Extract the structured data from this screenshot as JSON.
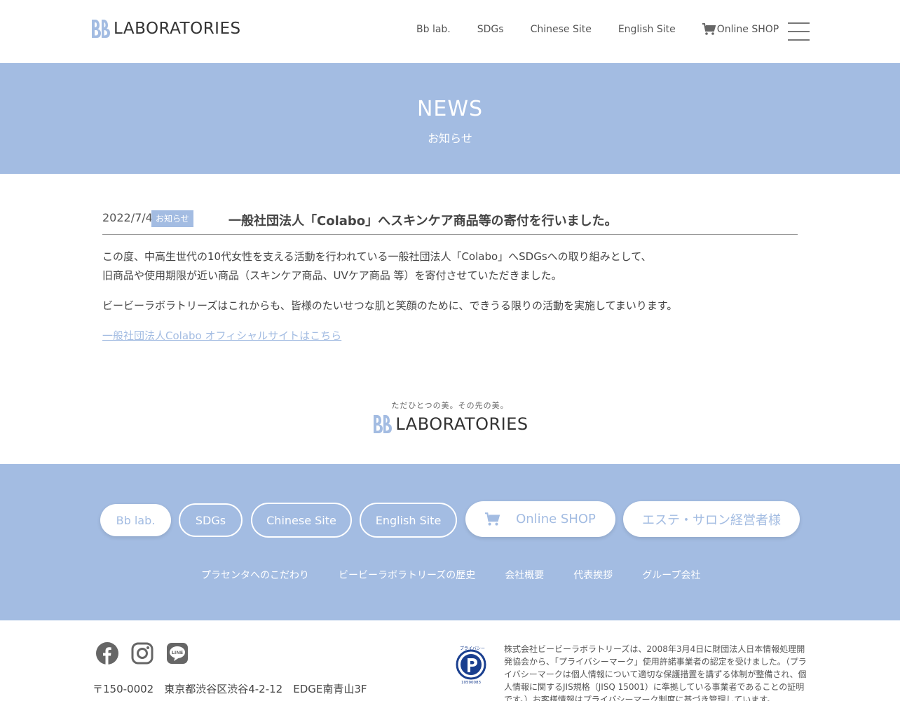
{
  "header": {
    "logo_mark": "Bb",
    "logo_text": "LABORATORIES",
    "nav": [
      "Bb lab.",
      "SDGs",
      "Chinese Site",
      "English Site"
    ],
    "shop_label": "Online SHOP"
  },
  "banner": {
    "title": "NEWS",
    "subtitle": "お知らせ"
  },
  "article": {
    "date": "2022/7/4",
    "badge": "お知らせ",
    "title": "一般社団法人「Colabo」へスキンケア商品等の寄付を行いました。",
    "para1_line1": "この度、中高生世代の10代女性を支える活動を行われている一般社団法人「Colabo」へSDGsへの取り組みとして、",
    "para1_line2": "旧商品や使用期限が近い商品（スキンケア商品、UVケア商品 等）を寄付させていただきました。",
    "para2": "ビービーラボラトリーズはこれからも、皆様のたいせつな肌と笑顔のために、できうる限りの活動を実施してまいります。",
    "link": "一般社団法人Colabo オフィシャルサイトはこちら"
  },
  "footer_logo": {
    "tagline": "ただひとつの美。その先の美。",
    "logo_mark": "Bb",
    "logo_text": "LABORATORIES"
  },
  "footer_nav": {
    "pills": [
      "Bb lab.",
      "SDGs",
      "Chinese Site",
      "English Site"
    ],
    "shop": "Online SHOP",
    "salon": "エステ・サロン経営者様",
    "links": [
      "プラセンタへのこだわり",
      "ビービーラボラトリーズの歴史",
      "会社概要",
      "代表挨拶",
      "グループ会社"
    ]
  },
  "bottom": {
    "address": "〒150-0002　東京都渋谷区渋谷4-2-12　EDGE南青山3F",
    "privacy_text": "株式会社ビービーラボラトリーズは、2008年3月4日に財団法人日本情報処理開発協会から、「プライバシーマーク」使用許諾事業者の認定を受けました。（プライバシーマークは個人情報について適切な保護措置を講ずる体制が整備され、個人情報に関するJIS規格（JISQ 15001）に準拠している事業者であることの証明です。）お客様情報はプライバシーマーク制度に基づき管理しています。",
    "pmark_label": "たいせつにしますプライバシー",
    "pmark_number": "10590083"
  },
  "colors": {
    "accent": "#a3bce2",
    "text": "#444444",
    "white": "#ffffff"
  },
  "icons": [
    "cart-icon",
    "menu-icon",
    "facebook-icon",
    "instagram-icon",
    "line-icon",
    "privacy-mark-icon"
  ]
}
